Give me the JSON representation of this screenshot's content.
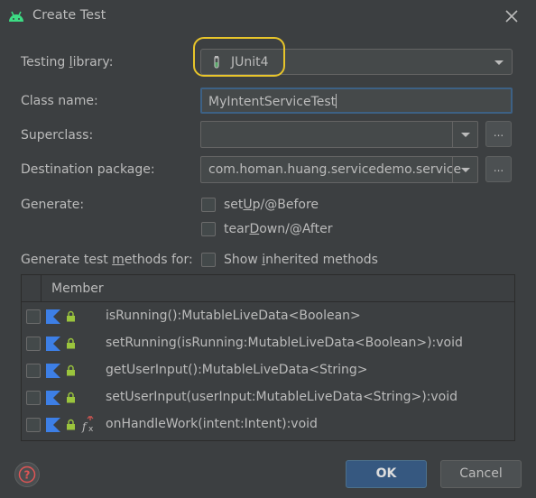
{
  "window": {
    "title": "Create Test",
    "icon": "android-icon"
  },
  "form": {
    "testing_library": {
      "label": "Testing library:",
      "mnemonic": "l",
      "value": "JUnit4"
    },
    "class_name": {
      "label": "Class name:",
      "value": "MyIntentServiceTest"
    },
    "superclass": {
      "label": "Superclass:",
      "value": "",
      "browse": "..."
    },
    "destination_package": {
      "label": "Destination package:",
      "value": "com.homan.huang.servicedemo.service",
      "browse": "..."
    },
    "generate": {
      "label": "Generate:",
      "options": [
        {
          "pre": "set",
          "key": "U",
          "post": "p/@Before",
          "checked": false
        },
        {
          "pre": "tear",
          "key": "D",
          "post": "own/@After",
          "checked": false
        }
      ]
    },
    "generate_methods": {
      "label_pre": "Generate test ",
      "label_key": "m",
      "label_post": "ethods for:",
      "show_inherited": {
        "pre": "Show ",
        "key": "i",
        "post": "nherited methods",
        "checked": false
      }
    }
  },
  "members_table": {
    "header": "Member",
    "rows": [
      {
        "signature": "isRunning():MutableLiveData<Boolean>",
        "checked": false,
        "icons": [
          "kotlin-icon",
          "lock-icon"
        ]
      },
      {
        "signature": "setRunning(isRunning:MutableLiveData<Boolean>):void",
        "checked": false,
        "icons": [
          "kotlin-icon",
          "lock-icon"
        ]
      },
      {
        "signature": "getUserInput():MutableLiveData<String>",
        "checked": false,
        "icons": [
          "kotlin-icon",
          "lock-icon"
        ]
      },
      {
        "signature": "setUserInput(userInput:MutableLiveData<String>):void",
        "checked": false,
        "icons": [
          "kotlin-icon",
          "lock-icon"
        ]
      },
      {
        "signature": "onHandleWork(intent:Intent):void",
        "checked": false,
        "icons": [
          "kotlin-icon",
          "lock-icon",
          "function-override-icon"
        ]
      }
    ]
  },
  "buttons": {
    "ok": "OK",
    "cancel": "Cancel",
    "help": "?"
  },
  "colors": {
    "background": "#3c3f41",
    "field": "#45494a",
    "ok_button": "#365880",
    "highlight": "#e8c52a",
    "kotlin": "#3d7fe6",
    "lock": "#9bc53d"
  }
}
